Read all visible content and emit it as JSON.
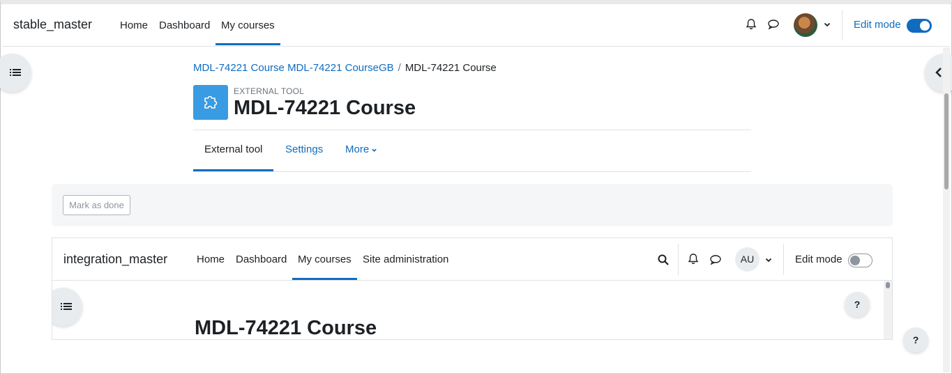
{
  "navbar": {
    "site_name": "stable_master",
    "items": [
      {
        "label": "Home"
      },
      {
        "label": "Dashboard"
      },
      {
        "label": "My courses"
      }
    ],
    "active_item": "My courses",
    "edit_mode_label": "Edit mode",
    "edit_mode_on": true
  },
  "breadcrumb": {
    "items": [
      {
        "label": "MDL-74221 Course MDL-74221 CourseGB"
      },
      {
        "label": "MDL-74221 Course"
      }
    ],
    "separator": "/"
  },
  "header": {
    "activity_type": "EXTERNAL TOOL",
    "title": "MDL-74221 Course",
    "icon": "puzzle-icon"
  },
  "tabs": [
    {
      "label": "External tool"
    },
    {
      "label": "Settings"
    },
    {
      "label": "More"
    }
  ],
  "completion": {
    "button_label": "Mark as done"
  },
  "embedded": {
    "site_name": "integration_master",
    "items": [
      {
        "label": "Home"
      },
      {
        "label": "Dashboard"
      },
      {
        "label": "My courses"
      },
      {
        "label": "Site administration"
      }
    ],
    "active_item": "My courses",
    "avatar_initials": "AU",
    "edit_mode_label": "Edit mode",
    "edit_mode_on": false,
    "page_title": "MDL-74221 Course",
    "help_label": "?"
  },
  "help_label": "?",
  "colors": {
    "primary": "#0f6cbf",
    "tool_icon_bg": "#399be2"
  }
}
